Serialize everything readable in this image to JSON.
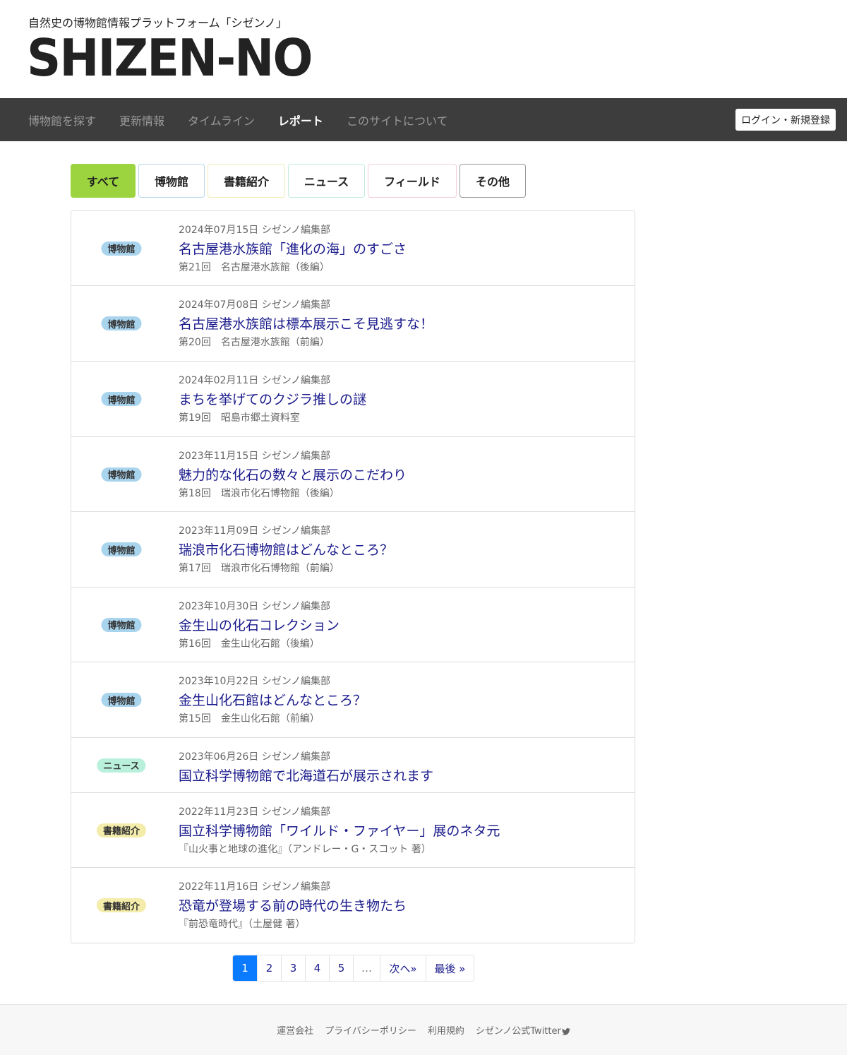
{
  "header": {
    "tagline": "自然史の博物館情報プラットフォーム「シゼンノ」",
    "logo": "SHIZEN-NO"
  },
  "nav": {
    "items": [
      {
        "label": "博物館を探す",
        "active": false
      },
      {
        "label": "更新情報",
        "active": false
      },
      {
        "label": "タイムライン",
        "active": false
      },
      {
        "label": "レポート",
        "active": true
      },
      {
        "label": "このサイトについて",
        "active": false
      }
    ],
    "login_label": "ログイン・新規登録"
  },
  "filters": [
    {
      "label": "すべて",
      "selected": true,
      "color": "#9bd43f"
    },
    {
      "label": "博物館",
      "selected": false,
      "color": "#b9d8ea"
    },
    {
      "label": "書籍紹介",
      "selected": false,
      "color": "#f0ecb8"
    },
    {
      "label": "ニュース",
      "selected": false,
      "color": "#c0ece0"
    },
    {
      "label": "フィールド",
      "selected": false,
      "color": "#f3cfd8"
    },
    {
      "label": "その他",
      "selected": false,
      "color": "#999999"
    }
  ],
  "tag_colors": {
    "博物館": "#a9d4ee",
    "ニュース": "#b8f0dc",
    "書籍紹介": "#f4ecaa"
  },
  "reports": [
    {
      "tag": "博物館",
      "meta": "2024年07月15日 シゼンノ編集部",
      "title": "名古屋港水族館「進化の海」のすごさ",
      "subtitle": "第21回　名古屋港水族館（後編）"
    },
    {
      "tag": "博物館",
      "meta": "2024年07月08日 シゼンノ編集部",
      "title": "名古屋港水族館は標本展示こそ見逃すな！",
      "subtitle": "第20回　名古屋港水族館（前編）"
    },
    {
      "tag": "博物館",
      "meta": "2024年02月11日 シゼンノ編集部",
      "title": "まちを挙げてのクジラ推しの謎",
      "subtitle": "第19回　昭島市郷土資料室"
    },
    {
      "tag": "博物館",
      "meta": "2023年11月15日 シゼンノ編集部",
      "title": "魅力的な化石の数々と展示のこだわり",
      "subtitle": "第18回　瑞浪市化石博物館（後編）"
    },
    {
      "tag": "博物館",
      "meta": "2023年11月09日 シゼンノ編集部",
      "title": "瑞浪市化石博物館はどんなところ？",
      "subtitle": "第17回　瑞浪市化石博物館（前編）"
    },
    {
      "tag": "博物館",
      "meta": "2023年10月30日 シゼンノ編集部",
      "title": "金生山の化石コレクション",
      "subtitle": "第16回　金生山化石館（後編）"
    },
    {
      "tag": "博物館",
      "meta": "2023年10月22日 シゼンノ編集部",
      "title": "金生山化石館はどんなところ？",
      "subtitle": "第15回　金生山化石館（前編）"
    },
    {
      "tag": "ニュース",
      "meta": "2023年06月26日 シゼンノ編集部",
      "title": "国立科学博物館で北海道石が展示されます",
      "subtitle": ""
    },
    {
      "tag": "書籍紹介",
      "meta": "2022年11月23日 シゼンノ編集部",
      "title": "国立科学博物館「ワイルド・ファイヤー」展のネタ元",
      "subtitle": "『山火事と地球の進化』（アンドレー・G・スコット 著）"
    },
    {
      "tag": "書籍紹介",
      "meta": "2022年11月16日 シゼンノ編集部",
      "title": "恐竜が登場する前の時代の生き物たち",
      "subtitle": "『前恐竜時代』（土屋健 著）"
    }
  ],
  "pagination": {
    "pages": [
      "1",
      "2",
      "3",
      "4",
      "5"
    ],
    "current": "1",
    "ellipsis": "…",
    "next_label": "次へ»",
    "last_label": "最後 »"
  },
  "footer": {
    "links": [
      "運営会社",
      "プライバシーポリシー",
      "利用規約",
      "シゼンノ公式Twitter"
    ],
    "twitter_icon": "twitter-bird-icon"
  }
}
